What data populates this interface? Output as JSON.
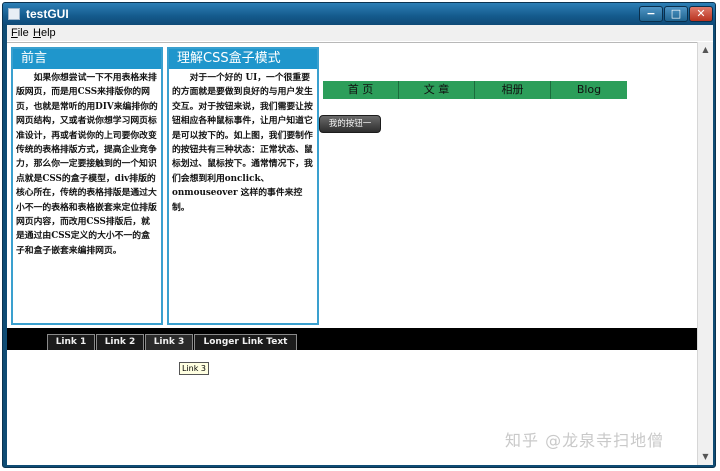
{
  "window": {
    "title": "testGUI",
    "controls": {
      "minimize": "−",
      "maximize": "□",
      "close": "✕"
    }
  },
  "menubar": {
    "file": {
      "mnemonic": "F",
      "rest": "ile"
    },
    "help": {
      "mnemonic": "H",
      "rest": "elp"
    }
  },
  "panels": {
    "left": {
      "title": "前言",
      "body": "如果你想尝试一下不用表格来排版网页，而是用CSS来排版你的网页，也就是常听的用DIV来编排你的网页结构，又或者说你想学习网页标准设计，再或者说你的上司要你改变传统的表格排版方式，提高企业竞争力，那么你一定要接触到的一个知识点就是CSS的盒子模型，div排版的核心所在，传统的表格排版是通过大小不一的表格和表格嵌套来定位排版网页内容，而改用CSS排版后，就是通过由CSS定义的大小不一的盒子和盒子嵌套来编排网页。"
    },
    "right": {
      "title": "理解CSS盒子模式",
      "body": "对于一个好的 UI，一个很重要的方面就是要做到良好的与用户发生交互。对于按钮来说，我们需要让按钮相应各种鼠标事件，让用户知道它是可以按下的。如上图，我们要制作的按钮共有三种状态：正常状态、鼠标划过、鼠标按下。通常情况下，我们会想到利用onclick、onmouseover 这样的事件来控制。"
    }
  },
  "nav1": {
    "items": [
      "首 页",
      "文 章",
      "相册",
      "Blog"
    ]
  },
  "button": {
    "label": "我的按钮一"
  },
  "nav2": {
    "tabs": [
      "Link 1",
      "Link 2",
      "Link 3",
      "Longer Link Text"
    ],
    "active": "Link 3"
  },
  "tooltip": {
    "text": "Link 3"
  },
  "watermark": {
    "text": "知乎 @龙泉寺扫地僧"
  },
  "colors": {
    "titlebar": "#145a8c",
    "panel_header": "#1f96cc",
    "nav1_bg": "#2c9e5a",
    "nav2_bg": "#000000"
  }
}
